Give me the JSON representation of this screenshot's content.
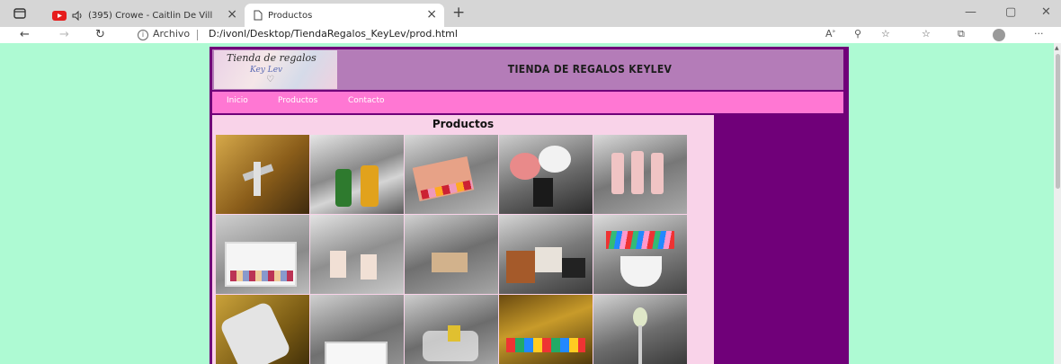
{
  "browser": {
    "tabs": [
      {
        "title": "(395) Crowe - Caitlin De Vill",
        "active": false
      },
      {
        "title": "Productos",
        "active": true
      }
    ],
    "address": {
      "scheme_label": "Archivo",
      "url": "D:/ivonl/Desktop/TiendaRegalos_KeyLev/prod.html"
    }
  },
  "site": {
    "logo_text": {
      "line1": "Tienda de regalos",
      "line2": "Key Lev"
    },
    "title": "TIENDA DE REGALOS KEYLEV",
    "menu": [
      {
        "label": "Inicio"
      },
      {
        "label": "Productos"
      },
      {
        "label": "Contacto"
      }
    ],
    "section_title": "Productos"
  },
  "colors": {
    "page_bg": "#aefad3",
    "site_frame": "#700079",
    "header_bg": "#b47cb8",
    "menu_bg": "#ff77d3",
    "content_bg": "#f9d3e9"
  }
}
